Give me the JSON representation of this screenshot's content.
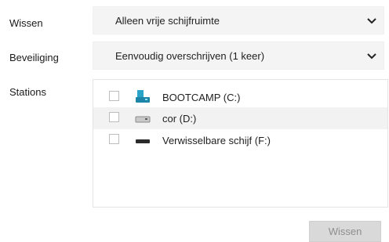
{
  "wipe": {
    "label": "Wissen",
    "selected": "Alleen vrije schijfruimte"
  },
  "security": {
    "label": "Beveiliging",
    "selected": "Eenvoudig overschrijven (1 keer)"
  },
  "stations": {
    "label": "Stations",
    "items": [
      {
        "name": "BOOTCAMP (C:)",
        "icon": "system-drive-icon",
        "checked": false
      },
      {
        "name": "cor (D:)",
        "icon": "hard-drive-icon",
        "checked": false
      },
      {
        "name": "Verwisselbare schijf (F:)",
        "icon": "removable-drive-icon",
        "checked": false
      }
    ]
  },
  "actions": {
    "wipe_button": "Wissen"
  },
  "colors": {
    "button_bg": "#d9d9d9",
    "button_text": "#8e8e8e",
    "select_bg": "#f4f4f4",
    "system_drive": "#2aa3c9"
  }
}
